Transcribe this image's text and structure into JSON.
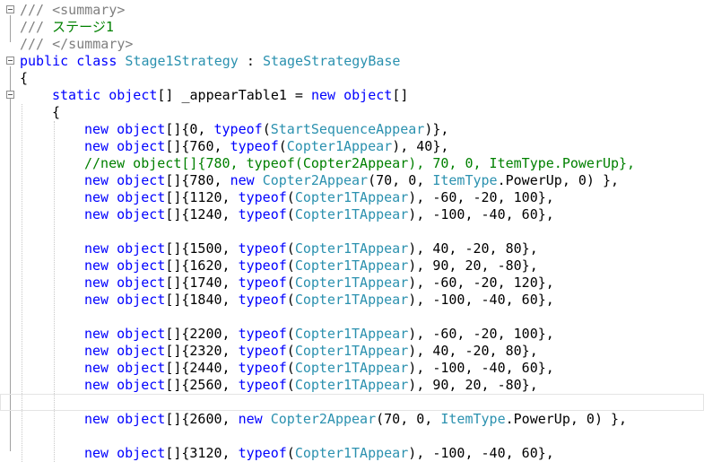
{
  "editor": {
    "lines": [
      {
        "fold": true,
        "indent": 0,
        "tokens": [
          [
            "dc",
            "/// <summary>"
          ]
        ]
      },
      {
        "fold": false,
        "indent": 0,
        "tokens": [
          [
            "dc",
            "/// "
          ],
          [
            "cm",
            "ステージ1"
          ]
        ]
      },
      {
        "fold": false,
        "indent": 0,
        "tokens": [
          [
            "dc",
            "/// </summary>"
          ]
        ]
      },
      {
        "fold": true,
        "indent": 0,
        "tokens": [
          [
            "kw",
            "public"
          ],
          [
            "tx",
            " "
          ],
          [
            "kw",
            "class"
          ],
          [
            "tx",
            " "
          ],
          [
            "ty",
            "Stage1Strategy"
          ],
          [
            "tx",
            " : "
          ],
          [
            "ty",
            "StageStrategyBase"
          ]
        ]
      },
      {
        "fold": false,
        "indent": 0,
        "tokens": [
          [
            "tx",
            "{"
          ]
        ]
      },
      {
        "fold": true,
        "indent": 1,
        "tokens": [
          [
            "kw",
            "static"
          ],
          [
            "tx",
            " "
          ],
          [
            "kw",
            "object"
          ],
          [
            "tx",
            "[] _appearTable1 = "
          ],
          [
            "kw",
            "new"
          ],
          [
            "tx",
            " "
          ],
          [
            "kw",
            "object"
          ],
          [
            "tx",
            "[]"
          ]
        ]
      },
      {
        "fold": false,
        "indent": 1,
        "tokens": [
          [
            "tx",
            "{"
          ]
        ]
      },
      {
        "fold": false,
        "indent": 2,
        "tokens": [
          [
            "kw",
            "new"
          ],
          [
            "tx",
            " "
          ],
          [
            "kw",
            "object"
          ],
          [
            "tx",
            "[]{0, "
          ],
          [
            "kw",
            "typeof"
          ],
          [
            "tx",
            "("
          ],
          [
            "ty",
            "StartSequenceAppear"
          ],
          [
            "tx",
            ")},"
          ]
        ]
      },
      {
        "fold": false,
        "indent": 2,
        "tokens": [
          [
            "kw",
            "new"
          ],
          [
            "tx",
            " "
          ],
          [
            "kw",
            "object"
          ],
          [
            "tx",
            "[]{760, "
          ],
          [
            "kw",
            "typeof"
          ],
          [
            "tx",
            "("
          ],
          [
            "ty",
            "Copter1Appear"
          ],
          [
            "tx",
            "), 40},"
          ]
        ]
      },
      {
        "fold": false,
        "indent": 2,
        "tokens": [
          [
            "cm",
            "//new object[]{780, typeof(Copter2Appear), 70, 0, ItemType.PowerUp},"
          ]
        ]
      },
      {
        "fold": false,
        "indent": 2,
        "tokens": [
          [
            "kw",
            "new"
          ],
          [
            "tx",
            " "
          ],
          [
            "kw",
            "object"
          ],
          [
            "tx",
            "[]{780, "
          ],
          [
            "kw",
            "new"
          ],
          [
            "tx",
            " "
          ],
          [
            "ty",
            "Copter2Appear"
          ],
          [
            "tx",
            "(70, 0, "
          ],
          [
            "ty",
            "ItemType"
          ],
          [
            "tx",
            ".PowerUp, 0) },"
          ]
        ]
      },
      {
        "fold": false,
        "indent": 2,
        "tokens": [
          [
            "kw",
            "new"
          ],
          [
            "tx",
            " "
          ],
          [
            "kw",
            "object"
          ],
          [
            "tx",
            "[]{1120, "
          ],
          [
            "kw",
            "typeof"
          ],
          [
            "tx",
            "("
          ],
          [
            "ty",
            "Copter1TAppear"
          ],
          [
            "tx",
            "), -60, -20, 100},"
          ]
        ]
      },
      {
        "fold": false,
        "indent": 2,
        "tokens": [
          [
            "kw",
            "new"
          ],
          [
            "tx",
            " "
          ],
          [
            "kw",
            "object"
          ],
          [
            "tx",
            "[]{1240, "
          ],
          [
            "kw",
            "typeof"
          ],
          [
            "tx",
            "("
          ],
          [
            "ty",
            "Copter1TAppear"
          ],
          [
            "tx",
            "), -100, -40, 60},"
          ]
        ]
      },
      {
        "fold": false,
        "indent": 2,
        "tokens": []
      },
      {
        "fold": false,
        "indent": 2,
        "tokens": [
          [
            "kw",
            "new"
          ],
          [
            "tx",
            " "
          ],
          [
            "kw",
            "object"
          ],
          [
            "tx",
            "[]{1500, "
          ],
          [
            "kw",
            "typeof"
          ],
          [
            "tx",
            "("
          ],
          [
            "ty",
            "Copter1TAppear"
          ],
          [
            "tx",
            "), 40, -20, 80},"
          ]
        ]
      },
      {
        "fold": false,
        "indent": 2,
        "tokens": [
          [
            "kw",
            "new"
          ],
          [
            "tx",
            " "
          ],
          [
            "kw",
            "object"
          ],
          [
            "tx",
            "[]{1620, "
          ],
          [
            "kw",
            "typeof"
          ],
          [
            "tx",
            "("
          ],
          [
            "ty",
            "Copter1TAppear"
          ],
          [
            "tx",
            "), 90, 20, -80},"
          ]
        ]
      },
      {
        "fold": false,
        "indent": 2,
        "tokens": [
          [
            "kw",
            "new"
          ],
          [
            "tx",
            " "
          ],
          [
            "kw",
            "object"
          ],
          [
            "tx",
            "[]{1740, "
          ],
          [
            "kw",
            "typeof"
          ],
          [
            "tx",
            "("
          ],
          [
            "ty",
            "Copter1TAppear"
          ],
          [
            "tx",
            "), -60, -20, 120},"
          ]
        ]
      },
      {
        "fold": false,
        "indent": 2,
        "tokens": [
          [
            "kw",
            "new"
          ],
          [
            "tx",
            " "
          ],
          [
            "kw",
            "object"
          ],
          [
            "tx",
            "[]{1840, "
          ],
          [
            "kw",
            "typeof"
          ],
          [
            "tx",
            "("
          ],
          [
            "ty",
            "Copter1TAppear"
          ],
          [
            "tx",
            "), -100, -40, 60},"
          ]
        ]
      },
      {
        "fold": false,
        "indent": 2,
        "tokens": []
      },
      {
        "fold": false,
        "indent": 2,
        "tokens": [
          [
            "kw",
            "new"
          ],
          [
            "tx",
            " "
          ],
          [
            "kw",
            "object"
          ],
          [
            "tx",
            "[]{2200, "
          ],
          [
            "kw",
            "typeof"
          ],
          [
            "tx",
            "("
          ],
          [
            "ty",
            "Copter1TAppear"
          ],
          [
            "tx",
            "), -60, -20, 100},"
          ]
        ]
      },
      {
        "fold": false,
        "indent": 2,
        "tokens": [
          [
            "kw",
            "new"
          ],
          [
            "tx",
            " "
          ],
          [
            "kw",
            "object"
          ],
          [
            "tx",
            "[]{2320, "
          ],
          [
            "kw",
            "typeof"
          ],
          [
            "tx",
            "("
          ],
          [
            "ty",
            "Copter1TAppear"
          ],
          [
            "tx",
            "), 40, -20, 80},"
          ]
        ]
      },
      {
        "fold": false,
        "indent": 2,
        "tokens": [
          [
            "kw",
            "new"
          ],
          [
            "tx",
            " "
          ],
          [
            "kw",
            "object"
          ],
          [
            "tx",
            "[]{2440, "
          ],
          [
            "kw",
            "typeof"
          ],
          [
            "tx",
            "("
          ],
          [
            "ty",
            "Copter1TAppear"
          ],
          [
            "tx",
            "), -100, -40, 60},"
          ]
        ]
      },
      {
        "fold": false,
        "indent": 2,
        "tokens": [
          [
            "kw",
            "new"
          ],
          [
            "tx",
            " "
          ],
          [
            "kw",
            "object"
          ],
          [
            "tx",
            "[]{2560, "
          ],
          [
            "kw",
            "typeof"
          ],
          [
            "tx",
            "("
          ],
          [
            "ty",
            "Copter1TAppear"
          ],
          [
            "tx",
            "), 90, 20, -80},"
          ]
        ]
      },
      {
        "fold": false,
        "indent": 2,
        "current": true,
        "tokens": []
      },
      {
        "fold": false,
        "indent": 2,
        "tokens": [
          [
            "kw",
            "new"
          ],
          [
            "tx",
            " "
          ],
          [
            "kw",
            "object"
          ],
          [
            "tx",
            "[]{2600, "
          ],
          [
            "kw",
            "new"
          ],
          [
            "tx",
            " "
          ],
          [
            "ty",
            "Copter2Appear"
          ],
          [
            "tx",
            "(70, 0, "
          ],
          [
            "ty",
            "ItemType"
          ],
          [
            "tx",
            ".PowerUp, 0) },"
          ]
        ]
      },
      {
        "fold": false,
        "indent": 2,
        "tokens": []
      },
      {
        "fold": false,
        "indent": 2,
        "tokens": [
          [
            "kw",
            "new"
          ],
          [
            "tx",
            " "
          ],
          [
            "kw",
            "object"
          ],
          [
            "tx",
            "[]{3120, "
          ],
          [
            "kw",
            "typeof"
          ],
          [
            "tx",
            "("
          ],
          [
            "ty",
            "Copter1TAppear"
          ],
          [
            "tx",
            "), -100, -40, 60},"
          ]
        ]
      }
    ]
  }
}
